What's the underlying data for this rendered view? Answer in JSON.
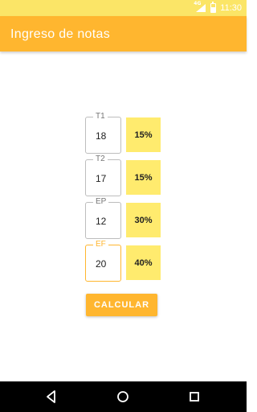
{
  "status_bar": {
    "time": "11:30",
    "signal_label": "4G",
    "battery_level": 0.6
  },
  "app_bar": {
    "title": "Ingreso de notas"
  },
  "grades": [
    {
      "label": "T1",
      "value": "18",
      "weight": "15%"
    },
    {
      "label": "T2",
      "value": "17",
      "weight": "15%"
    },
    {
      "label": "EP",
      "value": "12",
      "weight": "30%"
    },
    {
      "label": "EF",
      "value": "20",
      "weight": "40%"
    }
  ],
  "calc_button": {
    "label": "CALCULAR"
  },
  "colors": {
    "status_bar": "#FBE567",
    "app_bar": "#FFB62F",
    "weight_box": "#FFEB6E",
    "accent": "#FFB62F"
  },
  "nav": {
    "icons": [
      "back-icon",
      "home-icon",
      "recents-icon"
    ]
  }
}
